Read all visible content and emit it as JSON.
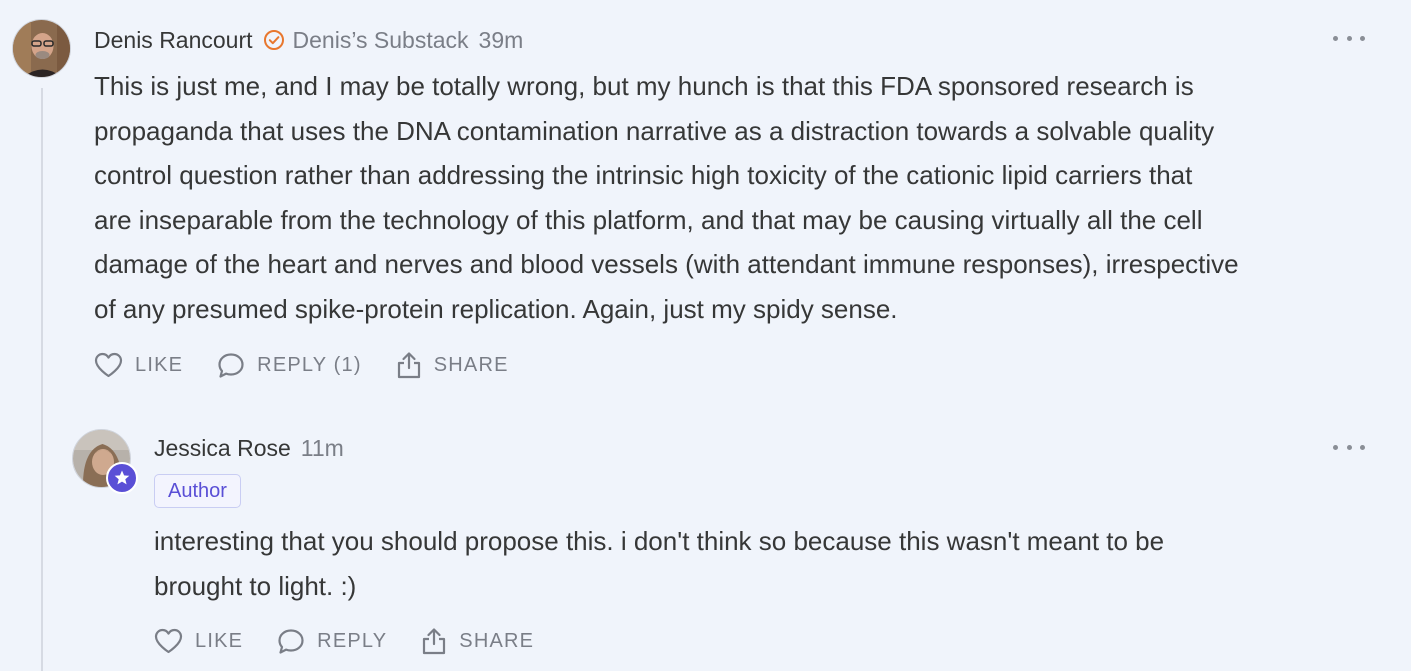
{
  "thread": {
    "comments": [
      {
        "author": "Denis Rancourt",
        "publication": "Denis’s Substack",
        "timestamp": "39m",
        "body_lines": [
          "This is just me, and I may be totally wrong, but my hunch is that this FDA sponsored research is",
          "propaganda that uses the DNA contamination narrative as a distraction towards a solvable quality",
          "control question rather than addressing the intrinsic high toxicity of the cationic lipid carriers that",
          "are inseparable from the technology of this platform, and that may be causing virtually all the cell",
          "damage of the heart and nerves and blood vessels (with attendant immune responses), irrespective",
          "of any presumed spike-protein replication. Again, just my spidy sense."
        ],
        "actions": {
          "like": "LIKE",
          "reply": "REPLY (1)",
          "share": "SHARE"
        },
        "icons": {
          "verified": "verified-check-icon",
          "more": "more-options-icon"
        }
      },
      {
        "author": "Jessica Rose",
        "timestamp": "11m",
        "badge": "Author",
        "body_lines": [
          "interesting that you should propose this. i don't think so because this wasn't meant to be",
          "brought to light. :)"
        ],
        "actions": {
          "like": "LIKE",
          "reply": "REPLY",
          "share": "SHARE"
        },
        "icons": {
          "author_badge": "star-icon",
          "more": "more-options-icon"
        }
      }
    ]
  },
  "colors": {
    "background": "#f0f4fb",
    "text": "#363737",
    "muted": "#7a7e87",
    "verified_orange": "#e8772e",
    "author_purple": "#5a4fd6"
  }
}
